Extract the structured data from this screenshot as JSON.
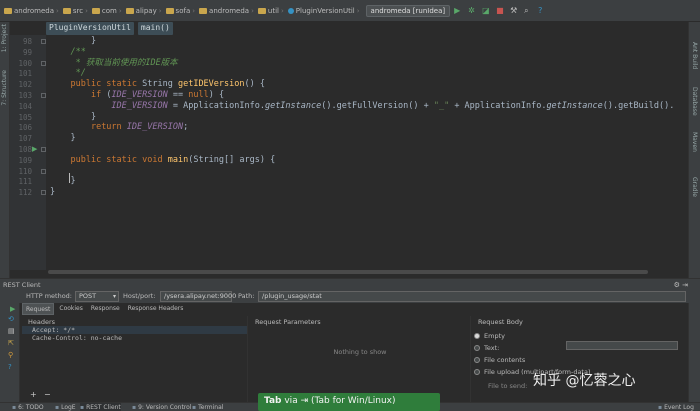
{
  "toolbar": {
    "breadcrumbs": [
      "andromeda",
      "src",
      "com",
      "alipay",
      "sofa",
      "andromeda",
      "util",
      "PluginVersionUtil"
    ],
    "run_config": "andromeda [runIdea]"
  },
  "left_tabs": [
    "1: Project",
    "7: Structure"
  ],
  "right_tabs": [
    "Ant Build",
    "Database",
    "Maven",
    "Gradle"
  ],
  "editor": {
    "crumbs": [
      "PluginVersionUtil",
      "main()"
    ],
    "line_numbers": [
      "98",
      "99",
      "100",
      "101",
      "102",
      "103",
      "104",
      "105",
      "106",
      "107",
      "108",
      "109",
      "110",
      "111",
      "112"
    ],
    "lines": [
      {
        "indent": "        ",
        "parts": [
          {
            "t": "}",
            "c": "pl"
          }
        ]
      },
      {
        "indent": "",
        "parts": []
      },
      {
        "indent": "    ",
        "parts": [
          {
            "t": "/**",
            "c": "cm"
          }
        ]
      },
      {
        "indent": "     ",
        "parts": [
          {
            "t": "* 获取当前使用的IDE版本",
            "c": "cm"
          }
        ]
      },
      {
        "indent": "     ",
        "parts": [
          {
            "t": "*/",
            "c": "cm"
          }
        ]
      },
      {
        "indent": "    ",
        "parts": [
          {
            "t": "public static ",
            "c": "kw"
          },
          {
            "t": "String ",
            "c": "pl"
          },
          {
            "t": "getIDEVersion",
            "c": "fn"
          },
          {
            "t": "() {",
            "c": "pl"
          }
        ]
      },
      {
        "indent": "        ",
        "parts": [
          {
            "t": "if ",
            "c": "kw"
          },
          {
            "t": "(",
            "c": "pl"
          },
          {
            "t": "IDE_VERSION",
            "c": "it"
          },
          {
            "t": " == ",
            "c": "pl"
          },
          {
            "t": "null",
            "c": "kw"
          },
          {
            "t": ") {",
            "c": "pl"
          }
        ]
      },
      {
        "indent": "            ",
        "parts": [
          {
            "t": "IDE_VERSION",
            "c": "it"
          },
          {
            "t": " = ApplicationInfo.",
            "c": "pl"
          },
          {
            "t": "getInstance",
            "c": "mi"
          },
          {
            "t": "().getFullVersion() + ",
            "c": "pl"
          },
          {
            "t": "\"_\"",
            "c": "st"
          },
          {
            "t": " + ApplicationInfo.",
            "c": "pl"
          },
          {
            "t": "getInstance",
            "c": "mi"
          },
          {
            "t": "().getBuild().",
            "c": "pl"
          }
        ]
      },
      {
        "indent": "        ",
        "parts": [
          {
            "t": "}",
            "c": "pl"
          }
        ]
      },
      {
        "indent": "        ",
        "parts": [
          {
            "t": "return ",
            "c": "kw"
          },
          {
            "t": "IDE_VERSION",
            "c": "it"
          },
          {
            "t": ";",
            "c": "pl"
          }
        ]
      },
      {
        "indent": "    ",
        "parts": [
          {
            "t": "}",
            "c": "pl"
          }
        ]
      },
      {
        "indent": "",
        "parts": []
      },
      {
        "indent": "    ",
        "parts": [
          {
            "t": "public static void ",
            "c": "kw"
          },
          {
            "t": "main",
            "c": "fn"
          },
          {
            "t": "(String[] args) {",
            "c": "pl"
          }
        ]
      },
      {
        "indent": "",
        "parts": []
      },
      {
        "indent": "    ",
        "parts": [
          {
            "t": "}",
            "c": "pl"
          }
        ]
      },
      {
        "indent": "",
        "parts": [
          {
            "t": "}",
            "c": "pl"
          }
        ]
      }
    ]
  },
  "rest": {
    "panel_title": "REST Client",
    "http_method_label": "HTTP method:",
    "http_method": "POST",
    "host_label": "Host/port:",
    "host": "/ysera.alipay.net:9000",
    "path_label": "Path:",
    "path": "/plugin_usage/stat",
    "tabs": [
      "Request",
      "Cookies",
      "Response",
      "Response Headers"
    ],
    "headers_title": "Headers",
    "header_lines": [
      "Accept: */*",
      "Cache-Control: no-cache"
    ],
    "params_title": "Request Parameters",
    "params_empty": "Nothing to show",
    "body_title": "Request Body",
    "body_options": [
      "Empty",
      "Text:",
      "File contents",
      "File upload (multipart/form-data)"
    ],
    "send_label": "File to send:"
  },
  "statusbar": {
    "items": [
      "6: TODO",
      "LogE",
      "REST Client",
      "9: Version Control",
      "Terminal",
      "Event Log"
    ]
  },
  "tooltip": {
    "key": "Tab",
    "rest": " via ⇥ (Tab for Win/Linux)"
  },
  "watermark": "知乎 @忆蓉之心"
}
